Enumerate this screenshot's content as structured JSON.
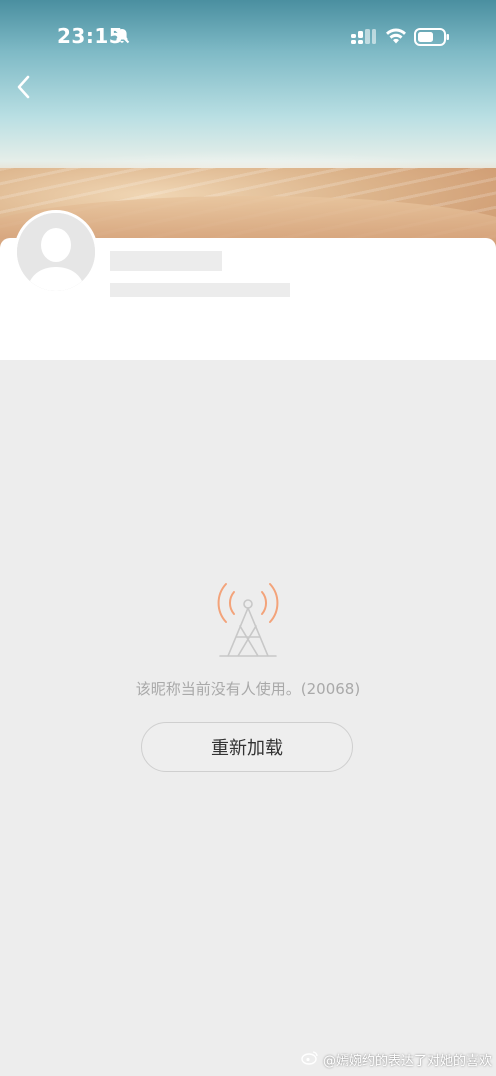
{
  "status_bar": {
    "time": "23:15"
  },
  "profile": {
    "name": "",
    "subtitle": ""
  },
  "empty_state": {
    "message": "该昵称当前没有人使用。(20068)",
    "reload_label": "重新加载"
  },
  "watermark": {
    "text": "@嫣婉约的表达了对她的喜欢"
  },
  "colors": {
    "page_bg": "#ededed",
    "icon_accent": "#f3a37a",
    "icon_gray": "#c8c8c8"
  },
  "icons": {
    "back": "chevron-left-icon",
    "mute": "bell-slash-icon",
    "signal": "signal-icon",
    "wifi": "wifi-icon",
    "battery": "battery-icon",
    "empty": "broadcast-tower-icon",
    "weibo": "weibo-icon"
  }
}
